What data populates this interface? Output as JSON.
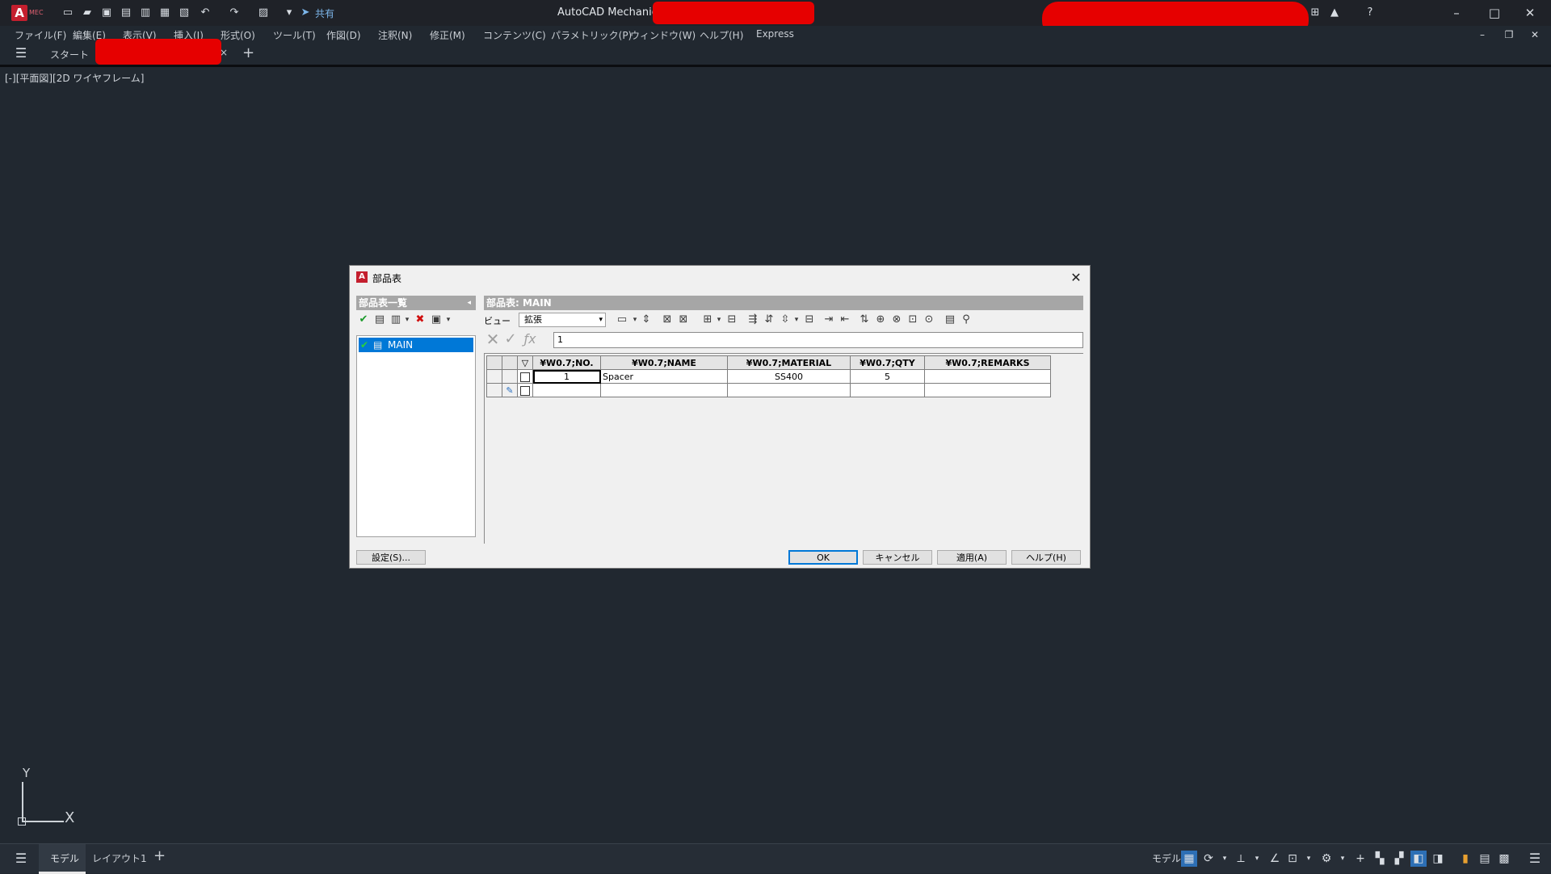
{
  "titlebar": {
    "app_logo": "A",
    "app_badge": "MEC",
    "share_label": "共有",
    "title": "AutoCAD Mechanical 2",
    "quick_icons": [
      "new-icon",
      "open-icon",
      "save-icon",
      "save-as-icon",
      "web-icon",
      "plot-icon",
      "print-icon",
      "undo-icon",
      "redo-icon",
      "workspace-icon",
      "dropdown-icon"
    ]
  },
  "menubar": {
    "items": [
      "ファイル(F)",
      "編集(E)",
      "表示(V)",
      "挿入(I)",
      "形式(O)",
      "ツール(T)",
      "作図(D)",
      "注釈(N)",
      "修正(M)",
      "コンテンツ(C)",
      "パラメトリック(P)",
      "ウィンドウ(W)",
      "ヘルプ(H)",
      "Express"
    ]
  },
  "tabbar": {
    "start_tab": "スタート",
    "add_tab": "+"
  },
  "viewport": {
    "label": "[-][平面図][2D ワイヤフレーム]"
  },
  "ucs": {
    "x_label": "X",
    "y_label": "Y"
  },
  "statusbar": {
    "model_tab": "モデル",
    "layout_tab": "レイアウト1",
    "add": "+",
    "model_label": "モデル"
  },
  "dialog": {
    "title": "部品表",
    "left_header": "部品表一覧",
    "right_header": "部品表: MAIN",
    "list_item": "MAIN",
    "view_label": "ビュー",
    "view_value": "拡張",
    "formula_value": "1",
    "columns": [
      "¥W0.7;NO.",
      "¥W0.7;NAME",
      "¥W0.7;MATERIAL",
      "¥W0.7;QTY",
      "¥W0.7;REMARKS"
    ],
    "rows": [
      {
        "no": "1",
        "name": "Spacer",
        "material": "SS400",
        "qty": "5",
        "remarks": ""
      },
      {
        "no": "",
        "name": "",
        "material": "",
        "qty": "",
        "remarks": ""
      }
    ],
    "buttons": {
      "settings": "設定(S)...",
      "ok": "OK",
      "cancel": "キャンセル",
      "apply": "適用(A)",
      "help": "ヘルプ(H)"
    }
  }
}
